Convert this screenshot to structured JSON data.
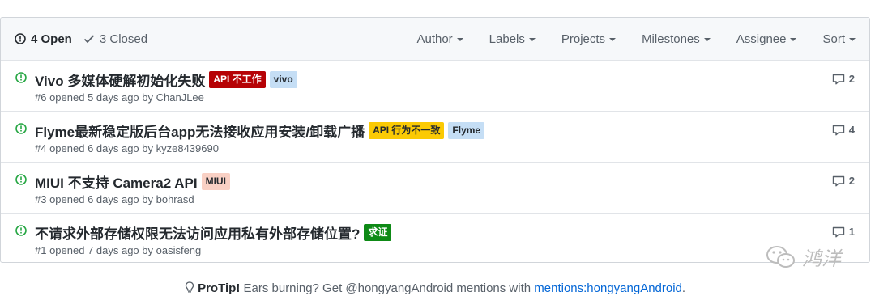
{
  "header": {
    "open_label": "4 Open",
    "closed_label": "3 Closed",
    "filters": [
      "Author",
      "Labels",
      "Projects",
      "Milestones",
      "Assignee",
      "Sort"
    ]
  },
  "issues": [
    {
      "title": "Vivo 多媒体硬解初始化失败",
      "meta": "#6 opened 5 days ago by ChanJLee",
      "comments": "2",
      "labels": [
        {
          "text": "API 不工作",
          "bg": "#b60205",
          "fg": "#ffffff"
        },
        {
          "text": "vivo",
          "bg": "#c5def5",
          "fg": "#24292e"
        }
      ]
    },
    {
      "title": "Flyme最新稳定版后台app无法接收应用安装/卸载广播",
      "meta": "#4 opened 6 days ago by kyze8439690",
      "comments": "4",
      "labels": [
        {
          "text": "API 行为不一致",
          "bg": "#fbca04",
          "fg": "#24292e"
        },
        {
          "text": "Flyme",
          "bg": "#c5def5",
          "fg": "#24292e"
        }
      ]
    },
    {
      "title": "MIUI 不支持 Camera2 API",
      "meta": "#3 opened 6 days ago by bohrasd",
      "comments": "2",
      "labels": [
        {
          "text": "MIUI",
          "bg": "#f9d0c4",
          "fg": "#24292e"
        }
      ]
    },
    {
      "title": "不请求外部存储权限无法访问应用私有外部存储位置?",
      "meta": "#1 opened 7 days ago by oasisfeng",
      "comments": "1",
      "labels": [
        {
          "text": "求证",
          "bg": "#0e8a16",
          "fg": "#ffffff"
        }
      ]
    }
  ],
  "watermark": {
    "text": "鸿洋",
    "icon": "wechat-icon"
  },
  "protip": {
    "strong": "ProTip!",
    "text": " Ears burning? Get @hongyangAndroid mentions with ",
    "link": "mentions:hongyangAndroid",
    "end": "."
  },
  "colors": {
    "open_icon": "#28a745",
    "border": "#d1d5da",
    "header_bg": "#f6f8fa",
    "link": "#0366d6"
  }
}
